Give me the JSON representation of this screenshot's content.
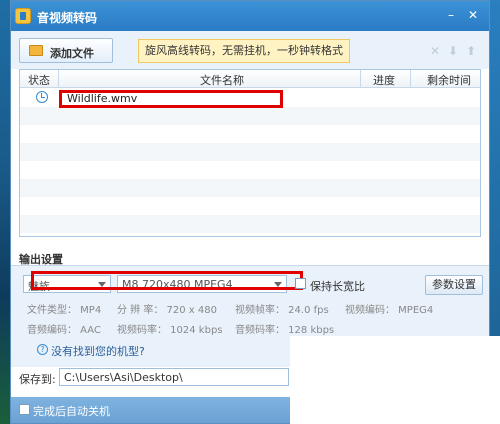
{
  "window": {
    "title": "音视频转码"
  },
  "toolbar": {
    "add_file_label": "添加文件",
    "promo_text": "旋风高线转码，无需挂机，一秒钟转格式",
    "icons": [
      "close-icon",
      "arrow-down-icon",
      "arrow-up-icon"
    ]
  },
  "table": {
    "headers": {
      "status": "状态",
      "filename": "文件名称",
      "progress": "进度",
      "remaining": "剩余时间"
    },
    "rows": [
      {
        "status_icon": "clock-icon",
        "filename": "Wildlife.wmv",
        "progress": "",
        "remaining": ""
      }
    ]
  },
  "output": {
    "section_title": "输出设置",
    "device_select": "魅族",
    "format_select": "M8 720x480 MPEG4",
    "keep_ratio_label": "保持长宽比",
    "param_button": "参数设置",
    "info": {
      "file_type": "文件类型：  MP4",
      "resolution": "分 辨 率：  720 x 480",
      "video_fps": "视频帧率：  24.0 fps",
      "video_codec": "视频编码：  MPEG4",
      "audio_codec": "音频编码：  AAC",
      "video_bitrate": "视频码率：  1024 kbps",
      "audio_bitrate": "音频码率：  128 kbps"
    },
    "help_text": "没有找到您的机型?"
  },
  "save": {
    "label": "保存到:",
    "path": "C:\\Users\\Asi\\Desktop\\"
  },
  "footer": {
    "shutdown_label": "完成后自动关机"
  },
  "colors": {
    "title_bar": "#2a7cc4",
    "highlight": "#e00000",
    "promo_bg": "#fff3c4"
  }
}
